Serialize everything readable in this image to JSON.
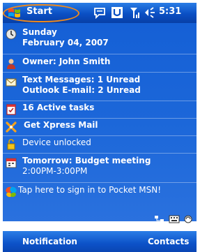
{
  "titlebar": {
    "start_label": "Start",
    "time": "5:31",
    "icons": [
      "windows-flag-icon",
      "message-bubble-icon",
      "u-badge-icon",
      "signal-icon",
      "speaker-icon"
    ]
  },
  "today": {
    "date_line1": "Sunday",
    "date_line2": "February 04, 2007",
    "owner": "Owner: John Smith",
    "messages_line1": "Text Messages: 1 Unread",
    "messages_line2": "Outlook E-mail: 2 Unread",
    "tasks": "16 Active tasks",
    "xpress": "Get Xpress Mail",
    "device": "Device unlocked",
    "meeting_title": "Tomorrow: Budget meeting",
    "meeting_time": "2:00PM-3:00PM",
    "msn": "Tap here to sign in to Pocket MSN!"
  },
  "softkeys": {
    "left": "Notification",
    "right": "Contacts"
  },
  "colors": {
    "accent": "#1560d6",
    "bar": "#0a4fc4",
    "highlight_ring": "#f08a1c"
  }
}
